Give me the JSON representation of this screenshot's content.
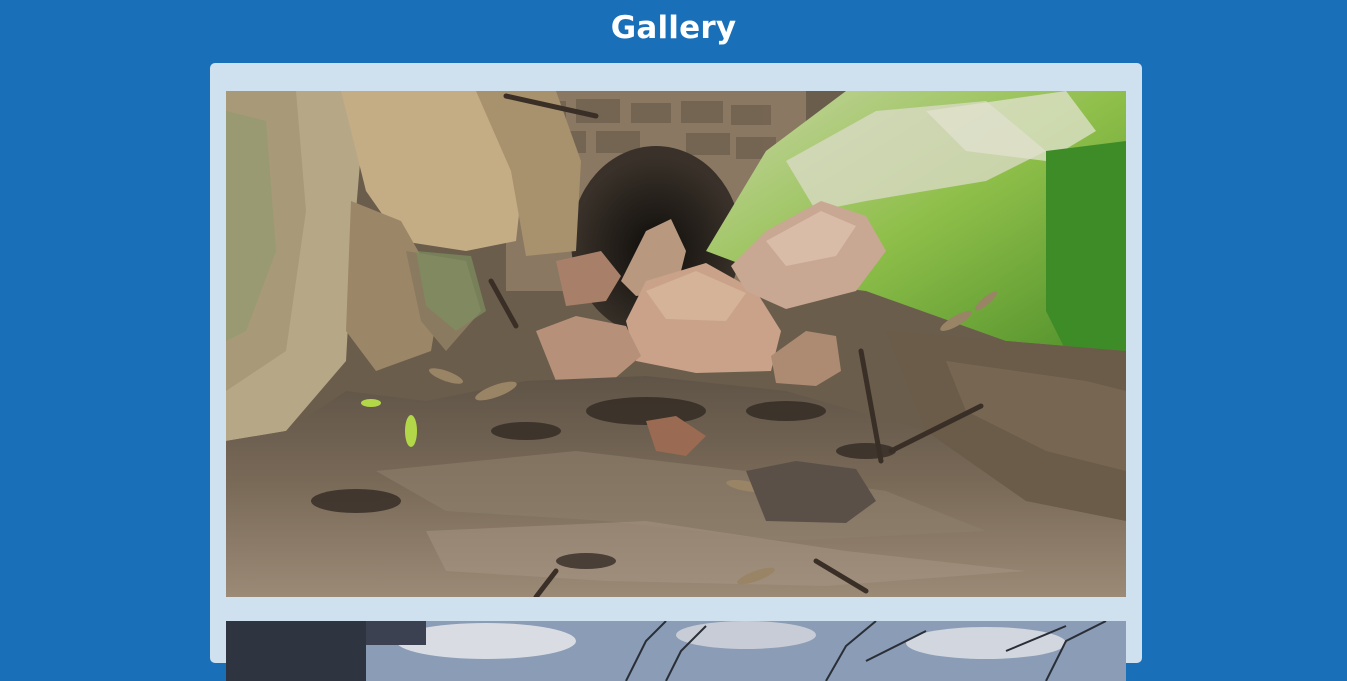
{
  "page": {
    "title": "Gallery"
  },
  "gallery": {
    "images": [
      {
        "subject": "rocky-stream-culvert-photo"
      },
      {
        "subject": "sky-with-bare-branches-photo"
      }
    ]
  },
  "colors": {
    "background": "#1a70b8",
    "panel": "#cfe0ee",
    "title_text": "#ffffff"
  }
}
